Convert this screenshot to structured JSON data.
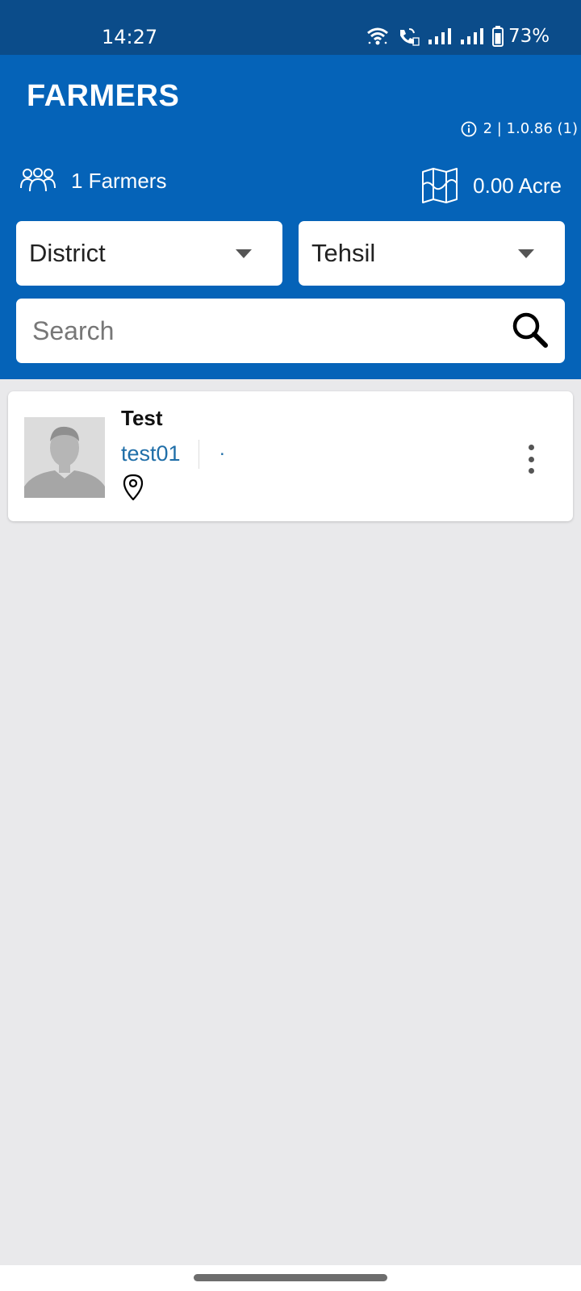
{
  "status_bar": {
    "time": "14:27",
    "battery": "73%",
    "icons": [
      "wifi-icon",
      "volte-call-icon",
      "signal-icon",
      "signal-icon",
      "battery-icon"
    ]
  },
  "header": {
    "title": "FARMERS",
    "version_info": "2 | 1.0.86 (1)",
    "farmers_count": "1 Farmers",
    "area": "0.00 Acre"
  },
  "filters": {
    "district_label": "District",
    "tehsil_label": "Tehsil"
  },
  "search": {
    "placeholder": "Search"
  },
  "farmers": [
    {
      "name": "Test",
      "code": "test01",
      "extra": "."
    }
  ],
  "colors": {
    "status_bar": "#0b4c8a",
    "header": "#0563b8",
    "background": "#e9e9eb",
    "link_text": "#1f6ea8"
  }
}
